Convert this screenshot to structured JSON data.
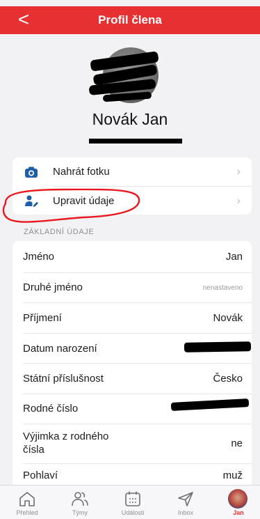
{
  "header": {
    "back_label": "<",
    "title": "Profil člena"
  },
  "profile": {
    "name": "Novák Jan"
  },
  "actions": [
    {
      "label": "Nahrát fotku",
      "icon": "camera-icon"
    },
    {
      "label": "Upravit údaje",
      "icon": "user-edit-icon"
    }
  ],
  "chevron": "›",
  "section": {
    "title": "ZÁKLADNÍ ÚDAJE"
  },
  "details": [
    {
      "label": "Jméno",
      "value": "Jan"
    },
    {
      "label": "Druhé jméno",
      "value": "nenastaveno"
    },
    {
      "label": "Příjmení",
      "value": "Novák"
    },
    {
      "label": "Datum narození",
      "value": ""
    },
    {
      "label": "Státní příslušnost",
      "value": "Česko"
    },
    {
      "label": "Rodné číslo",
      "value": ""
    },
    {
      "label": "Výjimka z rodného čísla",
      "value": "ne"
    },
    {
      "label": "Pohlaví",
      "value": "muž"
    }
  ],
  "tabs": [
    {
      "label": "Přehled",
      "icon": "home-icon"
    },
    {
      "label": "Týmy",
      "icon": "team-icon"
    },
    {
      "label": "Události",
      "icon": "calendar-icon"
    },
    {
      "label": "Inbox",
      "icon": "send-icon"
    },
    {
      "label": "Jan",
      "icon": "avatar",
      "active": true
    }
  ],
  "colors": {
    "brand": "#e63031",
    "icon_blue": "#1f5fa8",
    "annotation": "#e8181e"
  }
}
